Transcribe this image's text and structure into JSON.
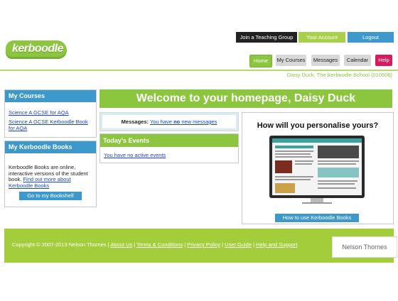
{
  "logo": {
    "text": "kerboodle"
  },
  "top_buttons": {
    "join": "Join a Teaching Group",
    "account": "Your Account",
    "logout": "Logout"
  },
  "nav": {
    "home": "Home",
    "my_courses": "My Courses",
    "messages": "Messages",
    "calendar": "Calendar",
    "help": "Help"
  },
  "user_line": "Daisy Duck,  The Kerboodle School (010606)",
  "my_courses": {
    "title": "My Courses",
    "items": [
      "Science A GCSE for AQA",
      "Science A GCSE Kerboodle Book for AQA"
    ]
  },
  "books": {
    "title": "My Kerboodle Books",
    "desc": "Kerboodle Books are online, interactive versions of the student book.",
    "link": "Find out more about Kerboodle Books",
    "button": "Go to my Bookshelf"
  },
  "welcome": "Welcome to your homepage, Daisy Duck",
  "messages": {
    "label": "Messages:",
    "pre": "You have ",
    "bold": "no",
    "post": " new messages"
  },
  "events": {
    "title": "Today's Events",
    "text": "You have no active events"
  },
  "promo": {
    "title": "How will you personalise yours?",
    "button": "How to use Kerboodle Books"
  },
  "footer": {
    "copyright": "Copyright © 2007-2013 Nelson Thornes",
    "links": [
      "About Us",
      "Terms & Conditions",
      "Privacy Policy",
      "User Guide",
      "Help and Support"
    ],
    "brand": "Nelson Thornes"
  },
  "colors": {
    "green": "#8cc63f",
    "blue": "#3d98cc",
    "dark": "#222222",
    "help": "#d81b5e"
  }
}
